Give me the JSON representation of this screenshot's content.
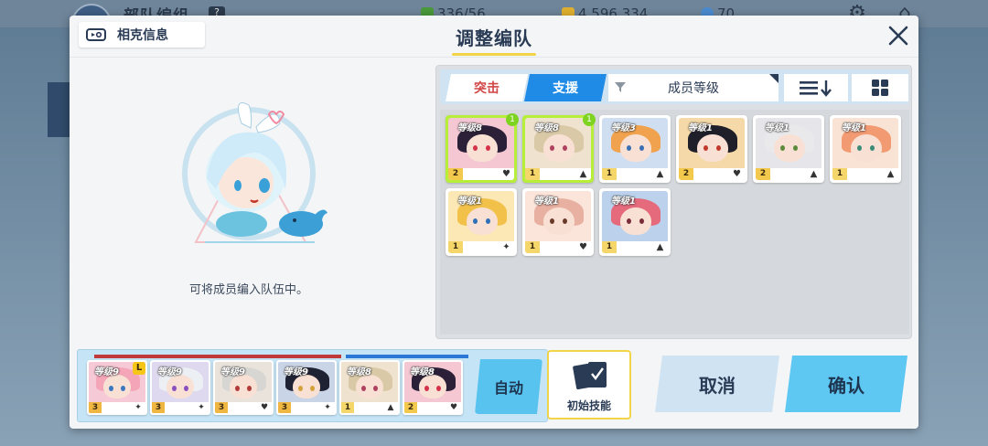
{
  "background": {
    "title": "部队编组",
    "badge": "?",
    "resource_1": "336/56",
    "resource_2": "4,596,334",
    "resource_3": "70"
  },
  "header": {
    "affinity_label": "相克信息",
    "title": "调整编队"
  },
  "left": {
    "hint": "可将成员编入队伍中。"
  },
  "filters": {
    "tab_assault": "突击",
    "tab_support": "支援",
    "sort_label": "成员等级",
    "sort_order_icon": "sort-descending-icon",
    "view_icon": "grid-view-icon"
  },
  "roster": [
    {
      "level": "等级8",
      "star": "2",
      "selected": true,
      "slot": "1",
      "role": "heal-icon",
      "hair": "#2b2038",
      "eye": "#d6314a",
      "bg": "#f4c7d3"
    },
    {
      "level": "等级8",
      "star": "1",
      "selected": true,
      "slot": "1",
      "role": "support-icon",
      "hair": "#d9c9a6",
      "eye": "#b04060",
      "bg": "#efe3d0"
    },
    {
      "level": "等级3",
      "star": "1",
      "selected": false,
      "slot": "",
      "role": "support-icon",
      "hair": "#f0a24e",
      "eye": "#3b6fb3",
      "bg": "#cfdff1"
    },
    {
      "level": "等级1",
      "star": "2",
      "selected": false,
      "slot": "",
      "role": "heal-icon",
      "hair": "#1f1f2a",
      "eye": "#c0392b",
      "bg": "#f5d9a8"
    },
    {
      "level": "等级1",
      "star": "2",
      "selected": false,
      "slot": "",
      "role": "support-icon",
      "hair": "#e9e9ec",
      "eye": "#5a8a3a",
      "bg": "#e5e5ea"
    },
    {
      "level": "等级1",
      "star": "1",
      "selected": false,
      "slot": "",
      "role": "support-icon",
      "hair": "#f29a72",
      "eye": "#3a8c77",
      "bg": "#f8e3d4"
    },
    {
      "level": "等级1",
      "star": "1",
      "selected": false,
      "slot": "",
      "role": "target-icon",
      "hair": "#f2c14a",
      "eye": "#2f6fb8",
      "bg": "#fbe8b4"
    },
    {
      "level": "等级1",
      "star": "1",
      "selected": false,
      "slot": "",
      "role": "heal-icon",
      "hair": "#e8b0a0",
      "eye": "#6b3b2a",
      "bg": "#fbe4da"
    },
    {
      "level": "等级1",
      "star": "1",
      "selected": false,
      "slot": "",
      "role": "support-icon",
      "hair": "#e46a7c",
      "eye": "#7a2c3a",
      "bg": "#bcd2ec"
    }
  ],
  "team": [
    {
      "level": "等级9",
      "star": "3",
      "leader": "L",
      "role": "target-icon",
      "hair": "#f4a6b8",
      "eye": "#3a77c0",
      "bg": "#f6c9d6"
    },
    {
      "level": "等级9",
      "star": "3",
      "leader": "",
      "role": "target-icon",
      "hair": "#eceff4",
      "eye": "#8a4fc0",
      "bg": "#ded9ee"
    },
    {
      "level": "等级9",
      "star": "3",
      "leader": "",
      "role": "heal-icon",
      "hair": "#d8d6d2",
      "eye": "#b13a3a",
      "bg": "#e9e3dc"
    },
    {
      "level": "等级9",
      "star": "3",
      "leader": "",
      "role": "target-icon",
      "hair": "#1f2233",
      "eye": "#d4a23a",
      "bg": "#c9d4e6"
    },
    {
      "level": "等级8",
      "star": "1",
      "leader": "",
      "role": "support-icon",
      "hair": "#d9c9a6",
      "eye": "#b04060",
      "bg": "#efe3d0"
    },
    {
      "level": "等级8",
      "star": "2",
      "leader": "",
      "role": "heal-icon",
      "hair": "#2b2038",
      "eye": "#d6314a",
      "bg": "#f4c7d3"
    }
  ],
  "actions": {
    "auto": "自动",
    "initial_skill": "初始技能",
    "cancel": "取消",
    "confirm": "确认"
  },
  "colors": {
    "accent_yellow": "#f2d448",
    "support_blue": "#1f8be6",
    "assault_red": "#d24545",
    "selected_green": "#b7ee3a"
  }
}
